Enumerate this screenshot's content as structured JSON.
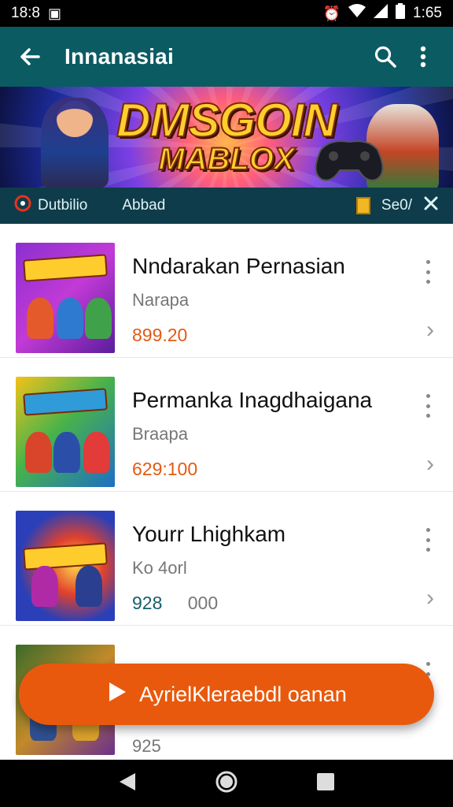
{
  "status_bar": {
    "time_left": "18:8",
    "time_right": "1:65"
  },
  "app_bar": {
    "title": "Innanasiai"
  },
  "banner": {
    "line1": "DMSGOIN",
    "line2": "MABLOX"
  },
  "chips": {
    "left": "Dutbilio",
    "middle": "Abbad",
    "right": "Se0/"
  },
  "items": [
    {
      "title": "Nndarakan Pernasian",
      "subtitle": "Narapa",
      "price": "899.20"
    },
    {
      "title": "Permanka Inagdhaigana",
      "subtitle": "Braapa",
      "price": "629:100"
    },
    {
      "title": "Yourr Lhighkam",
      "subtitle": "Ko 4orl",
      "price": "928",
      "price_extra": "000"
    },
    {
      "title": "",
      "subtitle": "925",
      "price": ""
    }
  ],
  "fab": {
    "label": "AyrielKleraebdl oanan"
  },
  "icons": [
    "back-arrow-icon",
    "search-icon",
    "more-vert-icon",
    "play-icon",
    "close-icon",
    "chevron-right-icon",
    "nav-back-icon",
    "nav-home-icon",
    "nav-recents-icon"
  ],
  "colors": {
    "app_bar": "#0b5b62",
    "accent": "#e8590d",
    "price": "#e35a12",
    "chip_row": "#0f3c4a"
  }
}
